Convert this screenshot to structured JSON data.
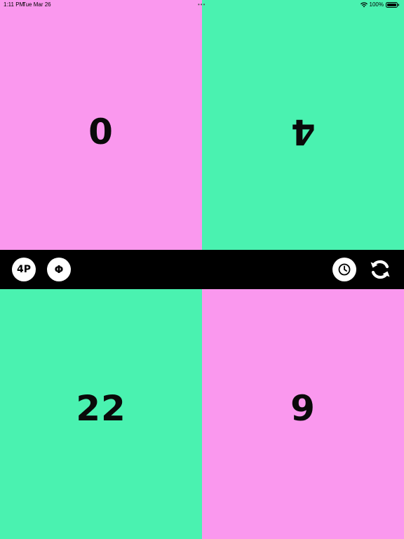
{
  "status_bar": {
    "time": "1:11 PM",
    "date": "Tue Mar 26",
    "multitask_dots": "•••",
    "battery": "100%",
    "icons": [
      "wifi-icon",
      "battery-icon"
    ]
  },
  "players": [
    {
      "id": "top-left",
      "score": "0",
      "color": "#fa98ee",
      "rotated": false
    },
    {
      "id": "top-right",
      "score": "4",
      "color": "#4af2b0",
      "rotated": true
    },
    {
      "id": "bottom-left",
      "score": "22",
      "color": "#4af2b0",
      "rotated": false
    },
    {
      "id": "bottom-right",
      "score": "9",
      "color": "#fa98ee",
      "rotated": false
    }
  ],
  "toolbar": {
    "player_count_label": "4P",
    "phi_label": "Φ",
    "icons": [
      "clock-icon",
      "refresh-icon"
    ]
  },
  "colors": {
    "pink": "#fa98ee",
    "green": "#4af2b0",
    "toolbar_bg": "#000000",
    "button_bg": "#ffffff"
  }
}
